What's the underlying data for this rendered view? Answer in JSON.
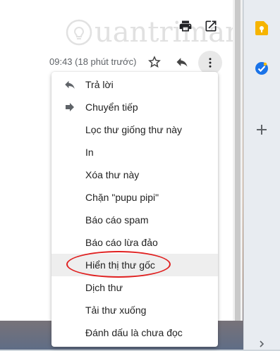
{
  "header": {
    "timestamp": "09:43 (18 phút trước)",
    "watermark_text": "uantrimang"
  },
  "icons": {
    "print": "print-icon",
    "popout": "open-in-new-window-icon",
    "star": "star-icon",
    "reply": "reply-icon",
    "more": "more-vert-icon",
    "keep": "google-keep-icon",
    "tasks": "google-tasks-icon",
    "add": "add-addon-icon"
  },
  "colors": {
    "highlight": "#e02020",
    "keep": "#f6b400",
    "tasks": "#1a73e8"
  },
  "menu": {
    "items": [
      {
        "label": "Trả lời",
        "icon": "reply-icon"
      },
      {
        "label": "Chuyển tiếp",
        "icon": "forward-icon"
      },
      {
        "label": "Lọc thư giống thư này"
      },
      {
        "label": "In"
      },
      {
        "label": "Xóa thư này"
      },
      {
        "label": "Chặn \"pupu pipi\""
      },
      {
        "label": "Báo cáo spam"
      },
      {
        "label": "Báo cáo lừa đảo"
      },
      {
        "label": "Hiển thị thư gốc",
        "highlighted": true
      },
      {
        "label": "Dịch thư"
      },
      {
        "label": "Tải thư xuống"
      },
      {
        "label": "Đánh dấu là chưa đọc"
      }
    ]
  }
}
